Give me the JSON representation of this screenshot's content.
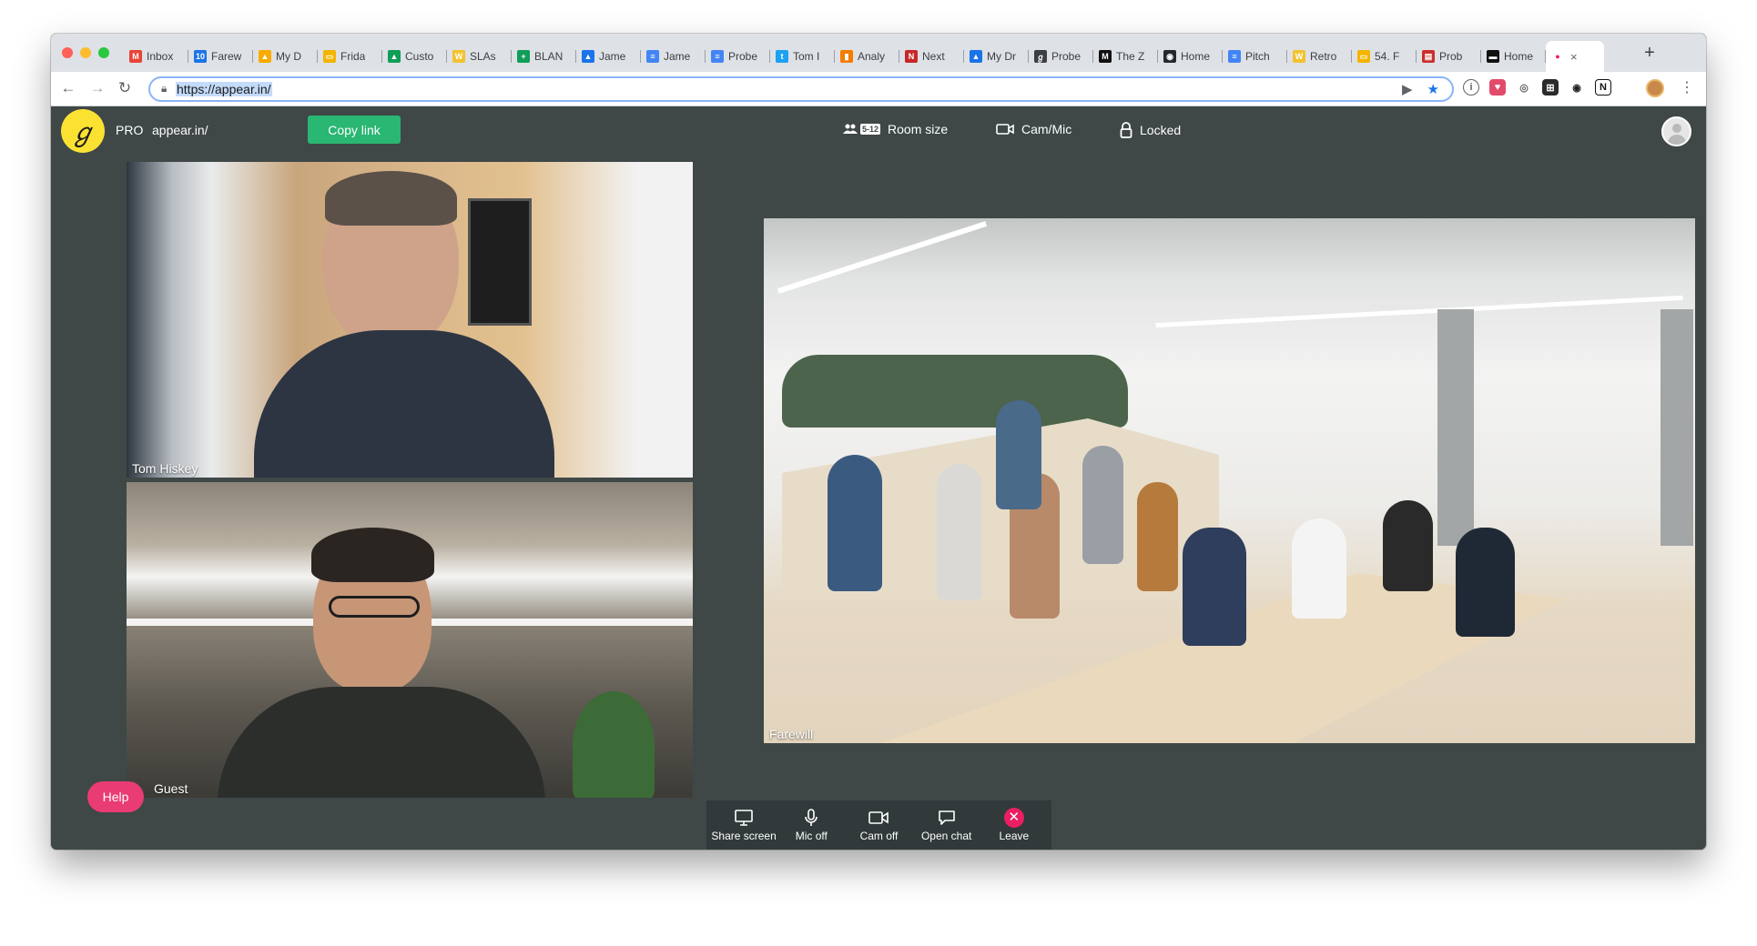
{
  "browser": {
    "tabs": [
      {
        "label": "Inbox",
        "icon": "gmail-icon",
        "color": "#ea4335",
        "glyph": "M"
      },
      {
        "label": "Farew",
        "icon": "calendar-icon",
        "color": "#1a73e8",
        "glyph": "10"
      },
      {
        "label": "My D",
        "icon": "drive-icon",
        "color": "#f9ab00",
        "glyph": "▲"
      },
      {
        "label": "Frida",
        "icon": "slides-icon",
        "color": "#f4b400",
        "glyph": "▭"
      },
      {
        "label": "Custo",
        "icon": "drive-icon",
        "color": "#0f9d58",
        "glyph": "▲"
      },
      {
        "label": "SLAs",
        "icon": "miro-icon",
        "color": "#f2c230",
        "glyph": "W"
      },
      {
        "label": "BLAN",
        "icon": "sheets-icon",
        "color": "#0f9d58",
        "glyph": "+"
      },
      {
        "label": "Jame",
        "icon": "drive-icon",
        "color": "#1a73e8",
        "glyph": "▲"
      },
      {
        "label": "Jame",
        "icon": "docs-icon",
        "color": "#4285f4",
        "glyph": "≡"
      },
      {
        "label": "Probe",
        "icon": "docs-icon",
        "color": "#4285f4",
        "glyph": "≡"
      },
      {
        "label": "Tom I",
        "icon": "twitter-icon",
        "color": "#1da1f2",
        "glyph": "t"
      },
      {
        "label": "Analy",
        "icon": "analytics-icon",
        "color": "#f57c00",
        "glyph": "▮"
      },
      {
        "label": "Next",
        "icon": "trello-icon",
        "color": "#c62828",
        "glyph": "N"
      },
      {
        "label": "My Dr",
        "icon": "drive-icon",
        "color": "#1a73e8",
        "glyph": "▲"
      },
      {
        "label": "Probe",
        "icon": "appear-icon",
        "color": "#3c4043",
        "glyph": "ℊ"
      },
      {
        "label": "The Z",
        "icon": "medium-icon",
        "color": "#111111",
        "glyph": "M"
      },
      {
        "label": "Home",
        "icon": "github-icon",
        "color": "#24292e",
        "glyph": "◉"
      },
      {
        "label": "Pitch",
        "icon": "docs-icon",
        "color": "#4285f4",
        "glyph": "≡"
      },
      {
        "label": "Retro",
        "icon": "miro-icon",
        "color": "#f2c230",
        "glyph": "W"
      },
      {
        "label": "54. F",
        "icon": "slides-icon",
        "color": "#f4b400",
        "glyph": "▭"
      },
      {
        "label": "Prob",
        "icon": "doc-icon",
        "color": "#c9302c",
        "glyph": "▤"
      },
      {
        "label": "Home",
        "icon": "tape-icon",
        "color": "#111111",
        "glyph": "▬"
      }
    ],
    "active_tab": {
      "icon": "appear-recording-icon",
      "color": "#e91e63",
      "close": "×"
    },
    "new_tab": "+",
    "url": "https://appear.in/"
  },
  "app": {
    "plan": "PRO",
    "room": "appear.in/",
    "copy_link": "Copy link",
    "room_size_badge": "5-12",
    "room_size": "Room size",
    "cam_mic": "Cam/Mic",
    "locked": "Locked",
    "help": "Help"
  },
  "participants": [
    {
      "name": "Tom Hiskey"
    },
    {
      "name": "Guest"
    },
    {
      "name": "Farewill"
    }
  ],
  "controls": [
    {
      "label": "Share screen",
      "icon": "monitor-icon"
    },
    {
      "label": "Mic off",
      "icon": "microphone-icon"
    },
    {
      "label": "Cam off",
      "icon": "camera-icon"
    },
    {
      "label": "Open chat",
      "icon": "chat-icon"
    },
    {
      "label": "Leave",
      "icon": "close-icon"
    }
  ],
  "colors": {
    "app_background": "#3f4847",
    "accent_green": "#2ab673",
    "logo_yellow": "#fbe232",
    "leave_pink": "#e91e63",
    "help_pink": "#e93b74"
  }
}
